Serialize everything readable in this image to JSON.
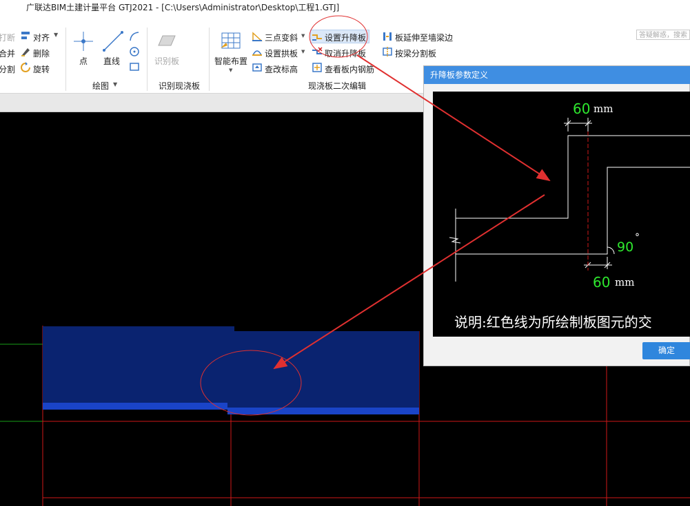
{
  "window": {
    "title": "广联达BIM土建计量平台 GTJ2021 - [C:\\Users\\Administrator\\Desktop\\工程1.GTJ]",
    "search_placeholder": "答疑解惑，搜索"
  },
  "ribbon": {
    "modify": {
      "break": "打断",
      "align": "对齐",
      "merge": "合并",
      "delete": "删除",
      "split": "分割",
      "rotate": "旋转"
    },
    "draw": {
      "point": "点",
      "line": "直线",
      "group": "绘图"
    },
    "recognize": {
      "slab": "识别板",
      "group": "识别现浇板"
    },
    "slab_edit": {
      "smart_layout": "智能布置",
      "three_point_slope": "三点变斜",
      "set_arch": "设置拱板",
      "check_elevation": "查改标高",
      "set_drop": "设置升降板",
      "cancel_drop": "取消升降板",
      "view_rebar": "查看板内钢筋",
      "extend_to_beam": "板延伸至墙梁边",
      "split_by_beam": "按梁分割板",
      "group": "现浇板二次编辑"
    }
  },
  "dialog": {
    "title": "升降板参数定义",
    "dim_top_value": "60",
    "dim_top_unit": "mm",
    "dim_bottom_value": "60",
    "dim_bottom_unit": "mm",
    "angle_value": "90",
    "angle_unit": "°",
    "note": "说明:红色线为所绘制板图元的交",
    "ok": "确定"
  },
  "colors": {
    "slab_fill": "#0a2370",
    "slab_edge": "#1a44c8",
    "grid": "#d01818",
    "axis": "#18a018",
    "annotation": "#e03030",
    "dim_text": "#2ee82e",
    "dialog_title": "#3f8ee2"
  }
}
